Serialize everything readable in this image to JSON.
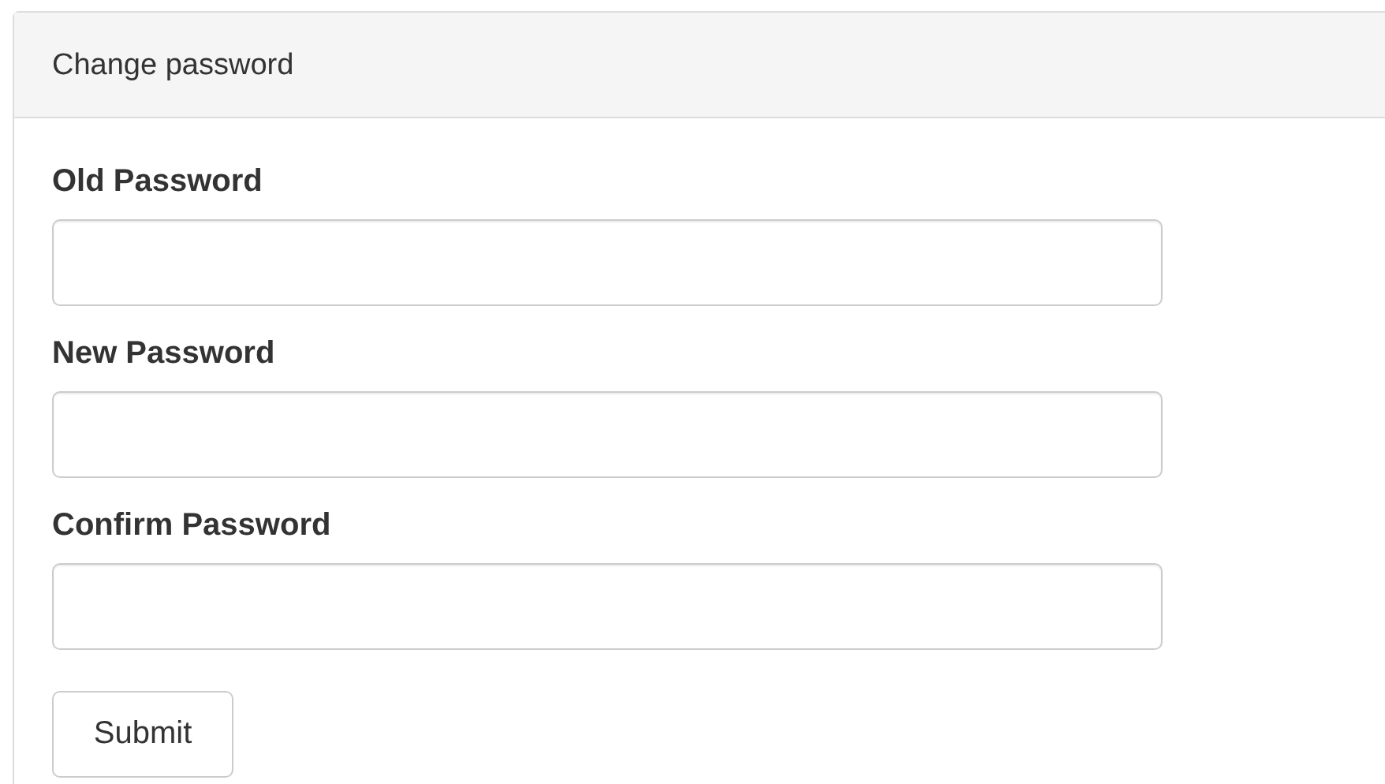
{
  "panel": {
    "title": "Change password"
  },
  "fields": [
    {
      "label": "Old Password"
    },
    {
      "label": "New Password"
    },
    {
      "label": "Confirm Password"
    }
  ],
  "submit_button": {
    "label": "Submit"
  }
}
